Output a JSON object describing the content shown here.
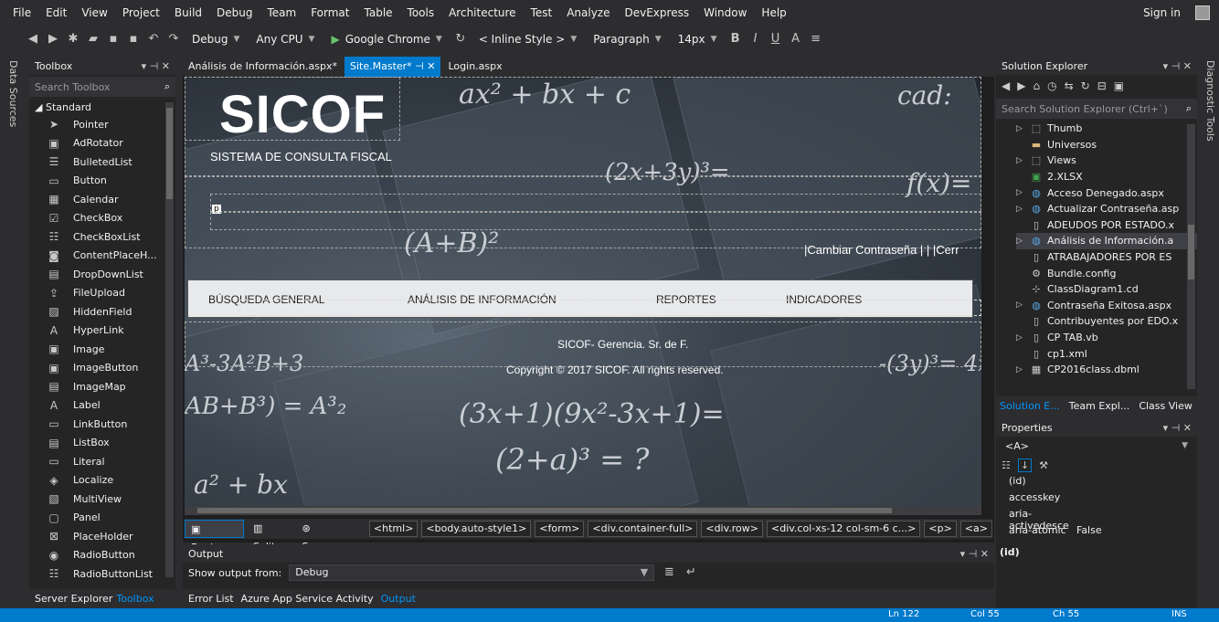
{
  "menu": [
    "File",
    "Edit",
    "View",
    "Project",
    "Build",
    "Debug",
    "Team",
    "Format",
    "Table",
    "Tools",
    "Architecture",
    "Test",
    "Analyze",
    "DevExpress",
    "Window",
    "Help"
  ],
  "signin": "Sign in",
  "toolbar": {
    "config": "Debug",
    "platform": "Any CPU",
    "browser": "Google Chrome",
    "style": "< Inline Style >",
    "block": "Paragraph",
    "size": "14px"
  },
  "left_vertical": "Data Sources",
  "right_vertical": "Diagnostic Tools",
  "toolbox": {
    "title": "Toolbox",
    "search": "Search Toolbox",
    "section": "Standard",
    "items": [
      {
        "icon": "pointer-icon",
        "glyph": "➤",
        "label": "Pointer"
      },
      {
        "icon": "adrotator-icon",
        "glyph": "▣",
        "label": "AdRotator"
      },
      {
        "icon": "bulletedlist-icon",
        "glyph": "☰",
        "label": "BulletedList"
      },
      {
        "icon": "button-icon",
        "glyph": "▭",
        "label": "Button"
      },
      {
        "icon": "calendar-icon",
        "glyph": "▦",
        "label": "Calendar"
      },
      {
        "icon": "checkbox-icon",
        "glyph": "☑",
        "label": "CheckBox"
      },
      {
        "icon": "checkboxlist-icon",
        "glyph": "☷",
        "label": "CheckBoxList"
      },
      {
        "icon": "contentplaceholder-icon",
        "glyph": "◙",
        "label": "ContentPlaceH..."
      },
      {
        "icon": "dropdownlist-icon",
        "glyph": "▤",
        "label": "DropDownList"
      },
      {
        "icon": "fileupload-icon",
        "glyph": "⇪",
        "label": "FileUpload"
      },
      {
        "icon": "hiddenfield-icon",
        "glyph": "▨",
        "label": "HiddenField"
      },
      {
        "icon": "hyperlink-icon",
        "glyph": "A",
        "label": "HyperLink"
      },
      {
        "icon": "image-icon",
        "glyph": "▣",
        "label": "Image"
      },
      {
        "icon": "imagebutton-icon",
        "glyph": "▣",
        "label": "ImageButton"
      },
      {
        "icon": "imagemap-icon",
        "glyph": "▤",
        "label": "ImageMap"
      },
      {
        "icon": "label-icon",
        "glyph": "A",
        "label": "Label"
      },
      {
        "icon": "linkbutton-icon",
        "glyph": "▭",
        "label": "LinkButton"
      },
      {
        "icon": "listbox-icon",
        "glyph": "▤",
        "label": "ListBox"
      },
      {
        "icon": "literal-icon",
        "glyph": "▭",
        "label": "Literal"
      },
      {
        "icon": "localize-icon",
        "glyph": "◈",
        "label": "Localize"
      },
      {
        "icon": "multiview-icon",
        "glyph": "▧",
        "label": "MultiView"
      },
      {
        "icon": "panel-icon",
        "glyph": "▢",
        "label": "Panel"
      },
      {
        "icon": "placeholder-icon",
        "glyph": "⊠",
        "label": "PlaceHolder"
      },
      {
        "icon": "radiobutton-icon",
        "glyph": "◉",
        "label": "RadioButton"
      },
      {
        "icon": "radiobuttonlist-icon",
        "glyph": "☷",
        "label": "RadioButtonList"
      }
    ],
    "tabs": [
      "Server Explorer",
      "Toolbox"
    ]
  },
  "doc_tabs": [
    {
      "label": "Análisis de Información.aspx*"
    },
    {
      "label": "Site.Master*"
    },
    {
      "label": "Login.aspx"
    }
  ],
  "design": {
    "title": "SICOF",
    "subtitle": "SISTEMA DE CONSULTA FISCAL",
    "p_marker": "p",
    "change_pw": "|Cambiar Contraseña | | |Cerr",
    "nav": [
      "BÚSQUEDA GENERAL",
      "ANÁLISIS DE INFORMACIÓN",
      "REPORTES",
      "INDICADORES"
    ],
    "footer1": "SICOF- Gerencia. Sr. de F.",
    "footer2": "Copyright © 2017 SICOF.  All rights reserved."
  },
  "view_buttons": [
    "Design",
    "Split",
    "Source"
  ],
  "breadcrumbs": [
    "<html>",
    "<body.auto-style1>",
    "<form>",
    "<div.container-full>",
    "<div.row>",
    "<div.col-xs-12 col-sm-6 c...>",
    "<p>",
    "<a>"
  ],
  "output": {
    "title": "Output",
    "show_from_label": "Show output from:",
    "source": "Debug"
  },
  "bottom_tabs": [
    "Error List",
    "Azure App Service Activity",
    "Output"
  ],
  "solution": {
    "title": "Solution Explorer",
    "search": "Search Solution Explorer (Ctrl+`)",
    "items": [
      {
        "exp": "▷",
        "icon": "folder-icon",
        "glyph": "⬚",
        "label": "Thumb"
      },
      {
        "exp": "",
        "icon": "folder-icon",
        "glyph": "▬",
        "label": "Universos"
      },
      {
        "exp": "▷",
        "icon": "folder-icon",
        "glyph": "⬚",
        "label": "Views"
      },
      {
        "exp": "",
        "icon": "excel-icon",
        "glyph": "▣",
        "label": "2.XLSX"
      },
      {
        "exp": "▷",
        "icon": "web-icon",
        "glyph": "◍",
        "label": "Acceso Denegado.aspx"
      },
      {
        "exp": "▷",
        "icon": "web-icon",
        "glyph": "◍",
        "label": "Actualizar Contraseña.asp"
      },
      {
        "exp": "",
        "icon": "file-icon",
        "glyph": "▯",
        "label": "ADEUDOS POR ESTADO.x"
      },
      {
        "exp": "▷",
        "icon": "web-icon",
        "glyph": "◍",
        "label": "Análisis de Información.a"
      },
      {
        "exp": "",
        "icon": "file-icon",
        "glyph": "▯",
        "label": "ATRABAJADORES POR ES"
      },
      {
        "exp": "",
        "icon": "config-icon",
        "glyph": "⚙",
        "label": "Bundle.config"
      },
      {
        "exp": "",
        "icon": "classdiagram-icon",
        "glyph": "⊹",
        "label": "ClassDiagram1.cd"
      },
      {
        "exp": "▷",
        "icon": "web-icon",
        "glyph": "◍",
        "label": "Contraseña Exitosa.aspx"
      },
      {
        "exp": "",
        "icon": "file-icon",
        "glyph": "▯",
        "label": "Contribuyentes por EDO.x"
      },
      {
        "exp": "▷",
        "icon": "vb-icon",
        "glyph": "▯",
        "label": "CP TAB.vb"
      },
      {
        "exp": "",
        "icon": "xml-icon",
        "glyph": "▯",
        "label": "cp1.xml"
      },
      {
        "exp": "▷",
        "icon": "dbml-icon",
        "glyph": "▦",
        "label": "CP2016class.dbml"
      }
    ],
    "tabs": [
      "Solution E...",
      "Team Expl...",
      "Class View"
    ]
  },
  "properties": {
    "title": "Properties",
    "element": "<A>",
    "rows": [
      {
        "k": "(id)",
        "v": ""
      },
      {
        "k": "accesskey",
        "v": ""
      },
      {
        "k": "aria-activedesce",
        "v": ""
      },
      {
        "k": "aria-atomic",
        "v": "False"
      }
    ],
    "desc": "(id)"
  },
  "status": {
    "ln": "Ln 122",
    "col": "Col 55",
    "ch": "Ch 55",
    "ins": "INS"
  },
  "colors": {
    "accent": "#007acc",
    "bg": "#2d2d30",
    "panel": "#252526",
    "link": "#0097fb"
  }
}
